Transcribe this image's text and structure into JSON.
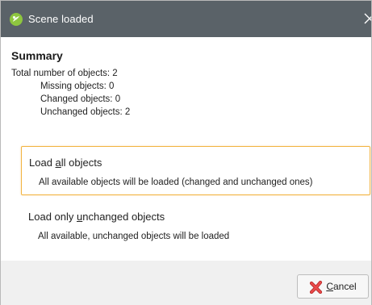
{
  "window": {
    "title": "Scene loaded",
    "app_icon": "scene-app-icon",
    "close_icon": "close-icon"
  },
  "summary": {
    "heading": "Summary",
    "total": "Total number of objects: 2",
    "missing": "Missing objects: 0",
    "changed": "Changed objects: 0",
    "unchanged": "Unchanged objects: 2"
  },
  "options": [
    {
      "title_prefix": "Load ",
      "title_accel": "a",
      "title_suffix": "ll objects",
      "description": "All available objects will be loaded (changed and unchanged ones)",
      "selected": true
    },
    {
      "title_prefix": "Load only ",
      "title_accel": "u",
      "title_suffix": "nchanged objects",
      "description": "All available, unchanged objects will be loaded",
      "selected": false
    }
  ],
  "footer": {
    "cancel_accel": "C",
    "cancel_rest": "ancel",
    "cancel_icon": "cancel-x-icon"
  },
  "colors": {
    "titlebar": "#5a6268",
    "selected_border": "#f2b340",
    "app_icon": "#8ec63f",
    "cancel_icon": "#e04040"
  }
}
